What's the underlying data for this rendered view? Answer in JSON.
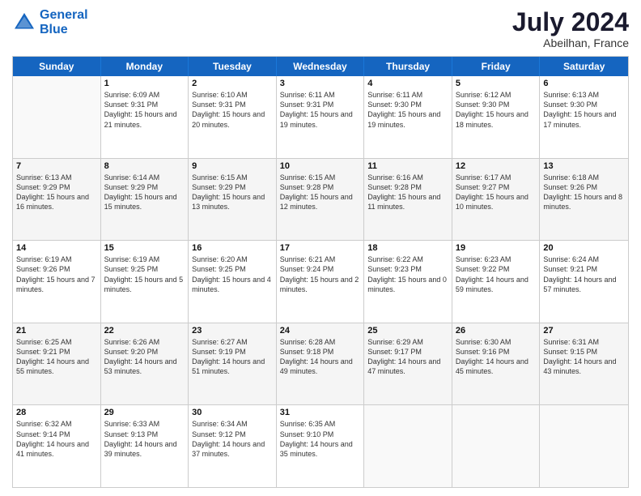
{
  "header": {
    "logo_line1": "General",
    "logo_line2": "Blue",
    "month": "July 2024",
    "location": "Abeilhan, France"
  },
  "days_of_week": [
    "Sunday",
    "Monday",
    "Tuesday",
    "Wednesday",
    "Thursday",
    "Friday",
    "Saturday"
  ],
  "weeks": [
    [
      {
        "day": "",
        "empty": true
      },
      {
        "day": "1",
        "sunrise": "Sunrise: 6:09 AM",
        "sunset": "Sunset: 9:31 PM",
        "daylight": "Daylight: 15 hours and 21 minutes."
      },
      {
        "day": "2",
        "sunrise": "Sunrise: 6:10 AM",
        "sunset": "Sunset: 9:31 PM",
        "daylight": "Daylight: 15 hours and 20 minutes."
      },
      {
        "day": "3",
        "sunrise": "Sunrise: 6:11 AM",
        "sunset": "Sunset: 9:31 PM",
        "daylight": "Daylight: 15 hours and 19 minutes."
      },
      {
        "day": "4",
        "sunrise": "Sunrise: 6:11 AM",
        "sunset": "Sunset: 9:30 PM",
        "daylight": "Daylight: 15 hours and 19 minutes."
      },
      {
        "day": "5",
        "sunrise": "Sunrise: 6:12 AM",
        "sunset": "Sunset: 9:30 PM",
        "daylight": "Daylight: 15 hours and 18 minutes."
      },
      {
        "day": "6",
        "sunrise": "Sunrise: 6:13 AM",
        "sunset": "Sunset: 9:30 PM",
        "daylight": "Daylight: 15 hours and 17 minutes."
      }
    ],
    [
      {
        "day": "7",
        "sunrise": "Sunrise: 6:13 AM",
        "sunset": "Sunset: 9:29 PM",
        "daylight": "Daylight: 15 hours and 16 minutes."
      },
      {
        "day": "8",
        "sunrise": "Sunrise: 6:14 AM",
        "sunset": "Sunset: 9:29 PM",
        "daylight": "Daylight: 15 hours and 15 minutes."
      },
      {
        "day": "9",
        "sunrise": "Sunrise: 6:15 AM",
        "sunset": "Sunset: 9:29 PM",
        "daylight": "Daylight: 15 hours and 13 minutes."
      },
      {
        "day": "10",
        "sunrise": "Sunrise: 6:15 AM",
        "sunset": "Sunset: 9:28 PM",
        "daylight": "Daylight: 15 hours and 12 minutes."
      },
      {
        "day": "11",
        "sunrise": "Sunrise: 6:16 AM",
        "sunset": "Sunset: 9:28 PM",
        "daylight": "Daylight: 15 hours and 11 minutes."
      },
      {
        "day": "12",
        "sunrise": "Sunrise: 6:17 AM",
        "sunset": "Sunset: 9:27 PM",
        "daylight": "Daylight: 15 hours and 10 minutes."
      },
      {
        "day": "13",
        "sunrise": "Sunrise: 6:18 AM",
        "sunset": "Sunset: 9:26 PM",
        "daylight": "Daylight: 15 hours and 8 minutes."
      }
    ],
    [
      {
        "day": "14",
        "sunrise": "Sunrise: 6:19 AM",
        "sunset": "Sunset: 9:26 PM",
        "daylight": "Daylight: 15 hours and 7 minutes."
      },
      {
        "day": "15",
        "sunrise": "Sunrise: 6:19 AM",
        "sunset": "Sunset: 9:25 PM",
        "daylight": "Daylight: 15 hours and 5 minutes."
      },
      {
        "day": "16",
        "sunrise": "Sunrise: 6:20 AM",
        "sunset": "Sunset: 9:25 PM",
        "daylight": "Daylight: 15 hours and 4 minutes."
      },
      {
        "day": "17",
        "sunrise": "Sunrise: 6:21 AM",
        "sunset": "Sunset: 9:24 PM",
        "daylight": "Daylight: 15 hours and 2 minutes."
      },
      {
        "day": "18",
        "sunrise": "Sunrise: 6:22 AM",
        "sunset": "Sunset: 9:23 PM",
        "daylight": "Daylight: 15 hours and 0 minutes."
      },
      {
        "day": "19",
        "sunrise": "Sunrise: 6:23 AM",
        "sunset": "Sunset: 9:22 PM",
        "daylight": "Daylight: 14 hours and 59 minutes."
      },
      {
        "day": "20",
        "sunrise": "Sunrise: 6:24 AM",
        "sunset": "Sunset: 9:21 PM",
        "daylight": "Daylight: 14 hours and 57 minutes."
      }
    ],
    [
      {
        "day": "21",
        "sunrise": "Sunrise: 6:25 AM",
        "sunset": "Sunset: 9:21 PM",
        "daylight": "Daylight: 14 hours and 55 minutes."
      },
      {
        "day": "22",
        "sunrise": "Sunrise: 6:26 AM",
        "sunset": "Sunset: 9:20 PM",
        "daylight": "Daylight: 14 hours and 53 minutes."
      },
      {
        "day": "23",
        "sunrise": "Sunrise: 6:27 AM",
        "sunset": "Sunset: 9:19 PM",
        "daylight": "Daylight: 14 hours and 51 minutes."
      },
      {
        "day": "24",
        "sunrise": "Sunrise: 6:28 AM",
        "sunset": "Sunset: 9:18 PM",
        "daylight": "Daylight: 14 hours and 49 minutes."
      },
      {
        "day": "25",
        "sunrise": "Sunrise: 6:29 AM",
        "sunset": "Sunset: 9:17 PM",
        "daylight": "Daylight: 14 hours and 47 minutes."
      },
      {
        "day": "26",
        "sunrise": "Sunrise: 6:30 AM",
        "sunset": "Sunset: 9:16 PM",
        "daylight": "Daylight: 14 hours and 45 minutes."
      },
      {
        "day": "27",
        "sunrise": "Sunrise: 6:31 AM",
        "sunset": "Sunset: 9:15 PM",
        "daylight": "Daylight: 14 hours and 43 minutes."
      }
    ],
    [
      {
        "day": "28",
        "sunrise": "Sunrise: 6:32 AM",
        "sunset": "Sunset: 9:14 PM",
        "daylight": "Daylight: 14 hours and 41 minutes."
      },
      {
        "day": "29",
        "sunrise": "Sunrise: 6:33 AM",
        "sunset": "Sunset: 9:13 PM",
        "daylight": "Daylight: 14 hours and 39 minutes."
      },
      {
        "day": "30",
        "sunrise": "Sunrise: 6:34 AM",
        "sunset": "Sunset: 9:12 PM",
        "daylight": "Daylight: 14 hours and 37 minutes."
      },
      {
        "day": "31",
        "sunrise": "Sunrise: 6:35 AM",
        "sunset": "Sunset: 9:10 PM",
        "daylight": "Daylight: 14 hours and 35 minutes."
      },
      {
        "day": "",
        "empty": true
      },
      {
        "day": "",
        "empty": true
      },
      {
        "day": "",
        "empty": true
      }
    ]
  ]
}
